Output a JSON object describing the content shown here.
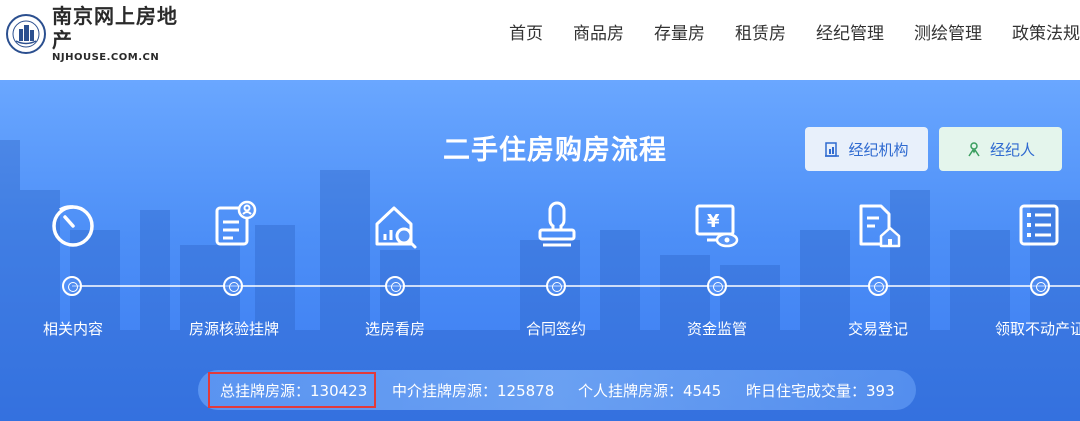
{
  "site": {
    "name_cn": "南京网上房地产",
    "name_en": "NJHOUSE.COM.CN"
  },
  "nav": [
    "首页",
    "商品房",
    "存量房",
    "租赁房",
    "经纪管理",
    "测绘管理",
    "政策法规"
  ],
  "banner": {
    "title": "二手住房购房流程",
    "buttons": {
      "agency": "经纪机构",
      "agent": "经纪人"
    },
    "steps": [
      {
        "label": "相关内容",
        "icon": "timer-icon"
      },
      {
        "label": "房源核验挂牌",
        "icon": "verify-document-icon"
      },
      {
        "label": "选房看房",
        "icon": "house-search-icon"
      },
      {
        "label": "合同签约",
        "icon": "stamp-icon"
      },
      {
        "label": "资金监管",
        "icon": "fund-monitor-icon"
      },
      {
        "label": "交易登记",
        "icon": "registration-document-icon"
      },
      {
        "label": "领取不动产证",
        "icon": "checklist-icon"
      }
    ]
  },
  "stats": {
    "total": "总挂牌房源：130423",
    "agency": "中介挂牌房源：125878",
    "personal": "个人挂牌房源：4545",
    "yesterday": "昨日住宅成交量：393"
  },
  "colors": {
    "banner": "#4d8ff7",
    "highlight": "#e23a3a",
    "button_text": "#2f6ad0"
  }
}
